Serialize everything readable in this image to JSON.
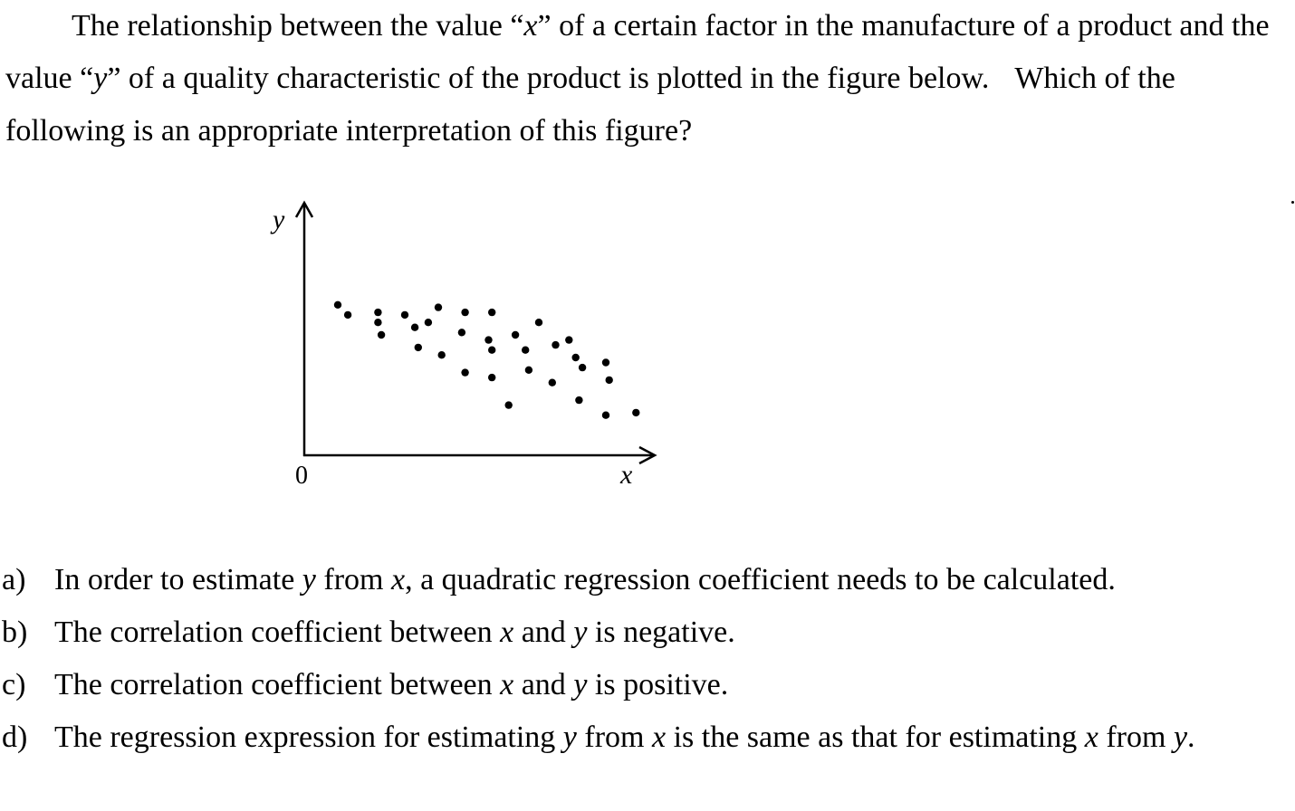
{
  "question": {
    "part1": "The relationship between the value “",
    "x": "x",
    "part2": "” of a certain factor in the manufacture of a product and the value “",
    "y": "y",
    "part3": "” of a quality characteristic of the product is plotted in the figure below.",
    "part4": "Which of the following is an appropriate interpretation of this figure?"
  },
  "figure": {
    "y_axis_label": "y",
    "x_axis_label": "x",
    "origin_label": "0"
  },
  "chart_data": {
    "type": "scatter",
    "title": "",
    "xlabel": "x",
    "ylabel": "y",
    "origin_label": "0",
    "xlim": [
      0,
      10
    ],
    "ylim": [
      0,
      10
    ],
    "points": [
      [
        1.0,
        6.0
      ],
      [
        1.3,
        5.6
      ],
      [
        2.2,
        5.7
      ],
      [
        2.2,
        5.3
      ],
      [
        2.3,
        4.8
      ],
      [
        3.0,
        5.6
      ],
      [
        3.3,
        5.1
      ],
      [
        3.4,
        4.3
      ],
      [
        3.7,
        5.3
      ],
      [
        4.0,
        5.9
      ],
      [
        4.1,
        4.0
      ],
      [
        4.8,
        5.7
      ],
      [
        4.7,
        4.9
      ],
      [
        4.8,
        3.3
      ],
      [
        5.6,
        5.7
      ],
      [
        5.5,
        4.6
      ],
      [
        5.6,
        4.2
      ],
      [
        5.6,
        3.1
      ],
      [
        6.1,
        2.0
      ],
      [
        6.3,
        4.8
      ],
      [
        6.6,
        4.2
      ],
      [
        6.7,
        3.4
      ],
      [
        7.0,
        5.3
      ],
      [
        7.4,
        2.9
      ],
      [
        7.5,
        4.4
      ],
      [
        7.9,
        4.6
      ],
      [
        8.1,
        3.9
      ],
      [
        8.2,
        2.2
      ],
      [
        8.3,
        3.5
      ],
      [
        9.0,
        3.7
      ],
      [
        9.1,
        3.0
      ],
      [
        9.0,
        1.6
      ],
      [
        9.9,
        1.7
      ]
    ]
  },
  "options": [
    {
      "letter": "a)",
      "t1": "In order to estimate ",
      "v1": "y",
      "t2": " from ",
      "v2": "x",
      "t3": ", a quadratic regression coefficient needs to be calculated."
    },
    {
      "letter": "b)",
      "t1": "The correlation coefficient between ",
      "v1": "x",
      "t2": " and ",
      "v2": "y",
      "t3": " is negative."
    },
    {
      "letter": "c)",
      "t1": "The correlation coefficient between ",
      "v1": "x",
      "t2": " and ",
      "v2": "y",
      "t3": " is positive."
    },
    {
      "letter": "d)",
      "t1": "The regression expression for estimating ",
      "v1": "y",
      "t2": " from ",
      "v2": "x",
      "t3": " is the same as that for estimating ",
      "v3": "x",
      "t4": " from ",
      "v4": "y",
      "t5": "."
    }
  ]
}
